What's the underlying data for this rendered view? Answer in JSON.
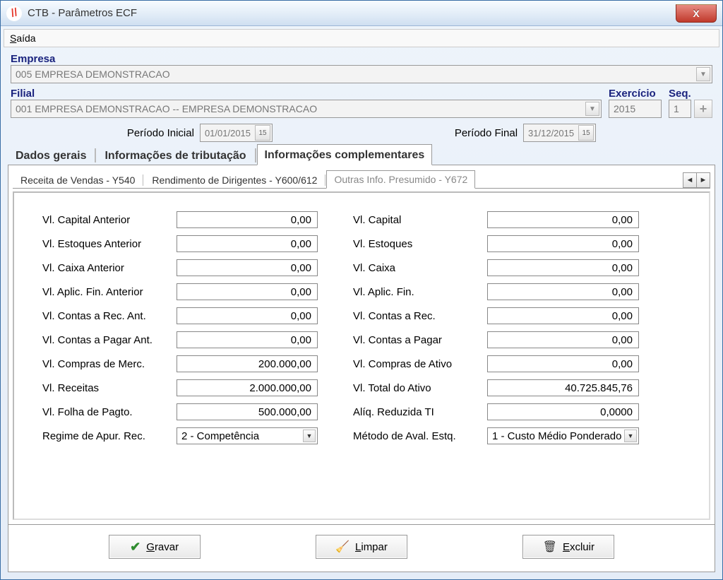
{
  "window": {
    "title": "CTB - Parâmetros ECF",
    "close_label": "X"
  },
  "menu": {
    "saida": "Saída",
    "saida_u": "S"
  },
  "labels": {
    "empresa": "Empresa",
    "filial": "Filial",
    "exercicio": "Exercício",
    "seq": "Seq.",
    "periodo_inicial": "Período Inicial",
    "periodo_final": "Período Final"
  },
  "values": {
    "empresa": "005 EMPRESA DEMONSTRACAO",
    "filial": "001 EMPRESA DEMONSTRACAO -- EMPRESA DEMONSTRACAO",
    "exercicio": "2015",
    "seq": "1",
    "periodo_inicial": "01/01/2015",
    "periodo_final": "31/12/2015"
  },
  "main_tabs": {
    "dados": "Dados gerais",
    "tributacao": "Informações de tributação",
    "complementares": "Informações complementares"
  },
  "sub_tabs": {
    "y540": "Receita de Vendas - Y540",
    "y600": "Rendimento de Dirigentes - Y600/612",
    "y672": "Outras Info. Presumido - Y672"
  },
  "fields": {
    "col1": [
      {
        "label": "Vl. Capital Anterior",
        "value": "0,00"
      },
      {
        "label": "Vl. Estoques Anterior",
        "value": "0,00"
      },
      {
        "label": "Vl. Caixa Anterior",
        "value": "0,00"
      },
      {
        "label": "Vl. Aplic. Fin. Anterior",
        "value": "0,00"
      },
      {
        "label": "Vl. Contas a Rec. Ant.",
        "value": "0,00"
      },
      {
        "label": "Vl. Contas a Pagar Ant.",
        "value": "0,00"
      },
      {
        "label": "Vl. Compras de Merc.",
        "value": "200.000,00"
      },
      {
        "label": "Vl. Receitas",
        "value": "2.000.000,00"
      },
      {
        "label": "Vl. Folha de Pagto.",
        "value": "500.000,00"
      }
    ],
    "col2": [
      {
        "label": "Vl. Capital",
        "value": "0,00"
      },
      {
        "label": "Vl. Estoques",
        "value": "0,00"
      },
      {
        "label": "Vl. Caixa",
        "value": "0,00"
      },
      {
        "label": "Vl. Aplic. Fin.",
        "value": "0,00"
      },
      {
        "label": "Vl. Contas a Rec.",
        "value": "0,00"
      },
      {
        "label": "Vl. Contas a Pagar",
        "value": "0,00"
      },
      {
        "label": "Vl. Compras de Ativo",
        "value": "0,00"
      },
      {
        "label": "Vl. Total do Ativo",
        "value": "40.725.845,76"
      },
      {
        "label": "Alíq. Reduzida TI",
        "value": "0,0000"
      }
    ],
    "regime_label": "Regime de Apur. Rec.",
    "regime_value": "2 - Competência",
    "metodo_label": "Método de Aval. Estq.",
    "metodo_value": "1 - Custo Médio Ponderado"
  },
  "buttons": {
    "gravar": "Gravar",
    "gravar_u": "G",
    "limpar": "Limpar",
    "limpar_u": "L",
    "excluir": "Excluir",
    "excluir_u": "E"
  }
}
